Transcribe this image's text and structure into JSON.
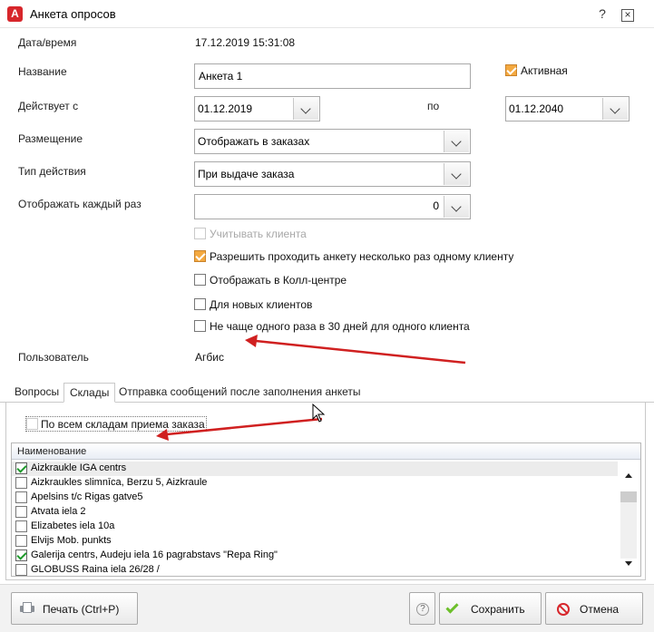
{
  "window": {
    "title": "Анкета опросов",
    "help_label": "?"
  },
  "form": {
    "datetime_label": "Дата/время",
    "datetime_value": "17.12.2019 15:31:08",
    "name_label": "Название",
    "name_value": "Анкета 1",
    "active_label": "Активная",
    "valid_from_label": "Действует с",
    "valid_from_value": "01.12.2019",
    "to_label": "по",
    "valid_to_value": "01.12.2040",
    "placement_label": "Размещение",
    "placement_value": "Отображать в заказах",
    "action_type_label": "Тип действия",
    "action_type_value": "При выдаче заказа",
    "show_every_label": "Отображать каждый раз",
    "show_every_value": "0",
    "user_label": "Пользователь",
    "user_value": "Агбис"
  },
  "checkboxes": [
    {
      "label": "Учитывать клиента",
      "checked": false,
      "disabled": true
    },
    {
      "label": "Разрешить проходить анкету несколько раз одному клиенту",
      "checked": true,
      "disabled": false
    },
    {
      "label": "Отображать в Колл-центре",
      "checked": false,
      "disabled": false
    },
    {
      "label": "Для новых клиентов",
      "checked": false,
      "disabled": false
    },
    {
      "label": "Не чаще одного раза в 30 дней для одного клиента",
      "checked": false,
      "disabled": false
    }
  ],
  "tabs": [
    {
      "label": "Вопросы",
      "active": false
    },
    {
      "label": "Склады",
      "active": true
    },
    {
      "label": "Отправка сообщений после заполнения анкеты",
      "active": false
    }
  ],
  "warehouses": {
    "all_label": "По всем складам приема заказа",
    "column_header": "Наименование",
    "rows": [
      {
        "name": "Aizkraukle IGA centrs",
        "checked": true
      },
      {
        "name": "Aizkraukles slimnīca, Berzu 5, Aizkraule",
        "checked": false
      },
      {
        "name": "Apelsins t/c Rigas gatve5",
        "checked": false
      },
      {
        "name": "Atvata iela  2",
        "checked": false
      },
      {
        "name": "Elizabetes iela 10a",
        "checked": false
      },
      {
        "name": "Elvijs Mob. punkts",
        "checked": false
      },
      {
        "name": "Galerija centrs, Audeju iela 16 pagrabstavs \"Repa Ring\"",
        "checked": true
      },
      {
        "name": "GLOBUSS Raina iela 26/28 /",
        "checked": false
      }
    ]
  },
  "footer": {
    "print_label": "Печать (Ctrl+P)",
    "help_label": "?",
    "save_label": "Сохранить",
    "cancel_label": "Отмена"
  },
  "colors": {
    "accent_orange": "#f4a940",
    "arrow_red": "#d02020",
    "brand_red": "#d7262b"
  }
}
